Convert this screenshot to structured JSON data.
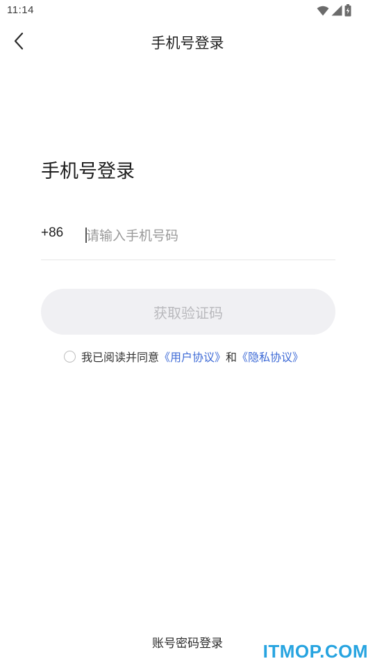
{
  "status_bar": {
    "time": "11:14",
    "icons": [
      "wifi-icon",
      "signal-icon",
      "battery-charging-icon"
    ]
  },
  "header": {
    "title": "手机号登录",
    "back_icon": "chevron-left-icon"
  },
  "main": {
    "heading": "手机号登录",
    "country_code": "+86",
    "phone_placeholder": "请输入手机号码",
    "phone_value": "",
    "get_code_label": "获取验证码",
    "agreement": {
      "prefix": "我已阅读并同意",
      "user_agreement": "《用户协议》",
      "conjunction": "和",
      "privacy_policy": "《隐私协议》",
      "checked": false
    }
  },
  "footer": {
    "account_login_label": "账号密码登录"
  },
  "watermark": "ITMOP.COM",
  "colors": {
    "link": "#3d6ad6",
    "button_bg": "#f0f0f3",
    "button_text": "#b9b9bd",
    "watermark": "#27a4e0"
  }
}
